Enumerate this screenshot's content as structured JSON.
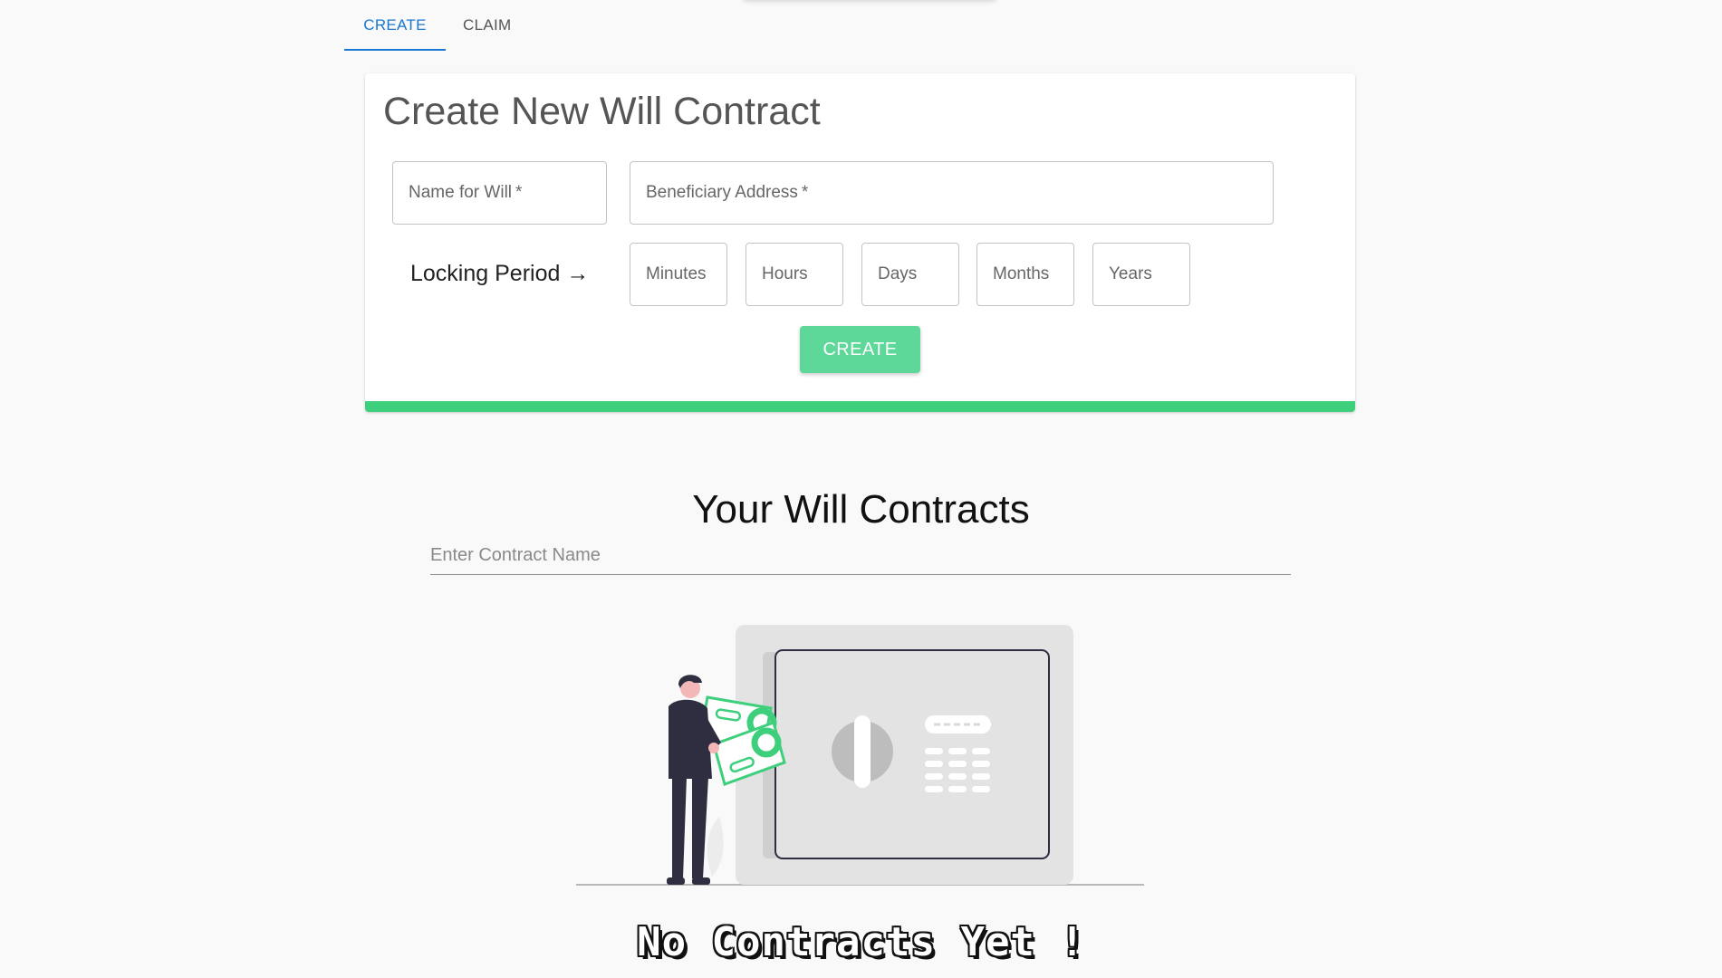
{
  "tabs": [
    {
      "label": "CREATE",
      "active": true
    },
    {
      "label": "CLAIM",
      "active": false
    }
  ],
  "create_form": {
    "title": "Create New Will Contract",
    "name_field": {
      "placeholder": "Name for Will",
      "required_mark": "*"
    },
    "beneficiary_field": {
      "placeholder": "Beneficiary Address",
      "required_mark": "*"
    },
    "locking_period_label": "Locking Period →",
    "period_fields": [
      "Minutes",
      "Hours",
      "Days",
      "Months",
      "Years"
    ],
    "submit_label": "CREATE"
  },
  "contracts": {
    "title": "Your Will Contracts",
    "search_placeholder": "Enter Contract Name",
    "empty_message": "No Contracts Yet !"
  },
  "colors": {
    "accent_blue": "#1976d2",
    "accent_green": "#3ecf7d",
    "button_green": "#5dd898"
  },
  "icons": {
    "illustration": "person-depositing-money-into-safe"
  }
}
